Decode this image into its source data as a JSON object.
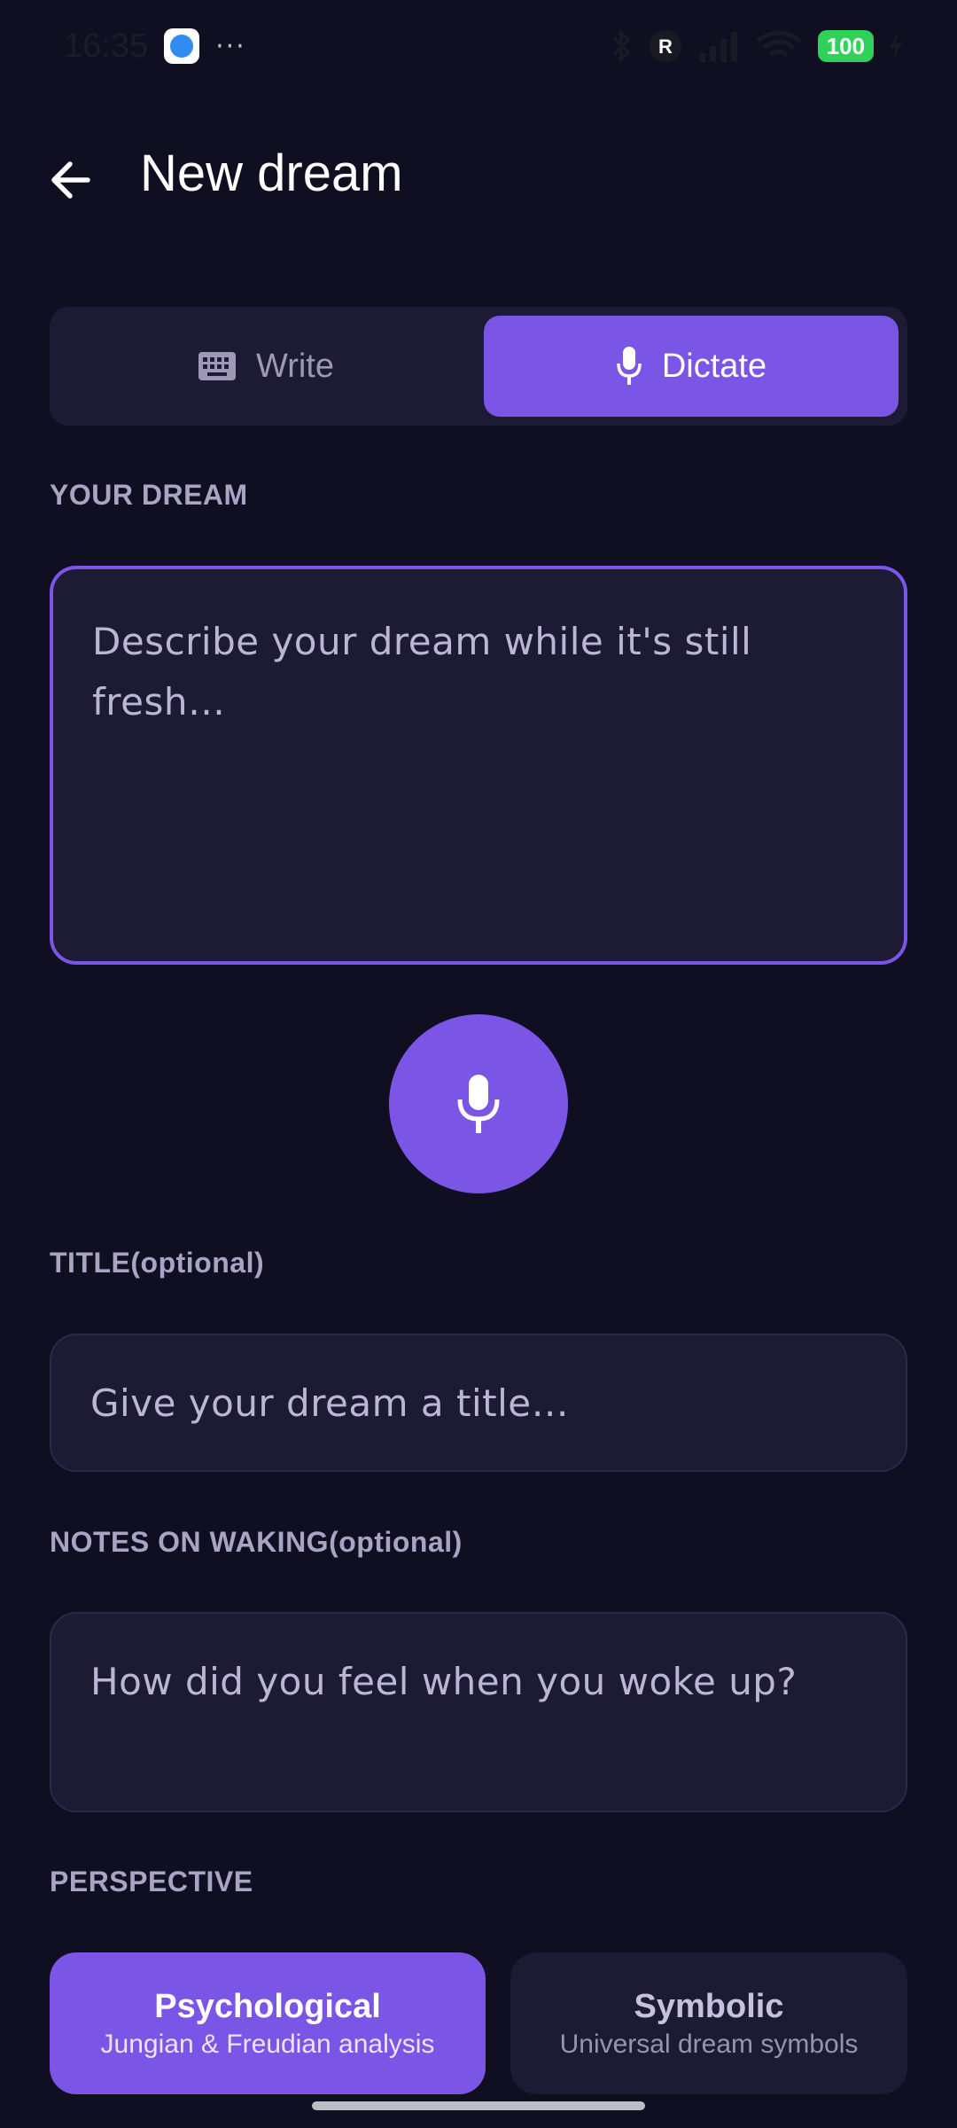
{
  "status_bar": {
    "time": "16:35",
    "dots": "···",
    "battery": "100"
  },
  "header": {
    "title": "New dream",
    "back_icon": "arrow-left-icon"
  },
  "mode_toggle": {
    "write_label": "Write",
    "dictate_label": "Dictate",
    "selected": "Dictate",
    "write_icon": "keyboard-icon",
    "dictate_icon": "microphone-icon"
  },
  "dream": {
    "label": "YOUR DREAM",
    "placeholder": "Describe your dream while it's still fresh…",
    "mic_icon": "microphone-icon"
  },
  "title_field": {
    "label": "TITLE(optional)",
    "placeholder": "Give your dream a title…"
  },
  "notes_field": {
    "label": "NOTES ON WAKING(optional)",
    "placeholder": "How did you feel when you woke up?"
  },
  "perspective": {
    "label": "PERSPECTIVE",
    "options": [
      {
        "name": "Psychological",
        "description": "Jungian & Freudian analysis",
        "selected": true
      },
      {
        "name": "Symbolic",
        "description": "Universal dream symbols",
        "selected": false
      }
    ]
  },
  "colors": {
    "background": "#100f22",
    "surface": "#1d1b33",
    "accent": "#7b55e6",
    "label": "#a9a3c4"
  }
}
